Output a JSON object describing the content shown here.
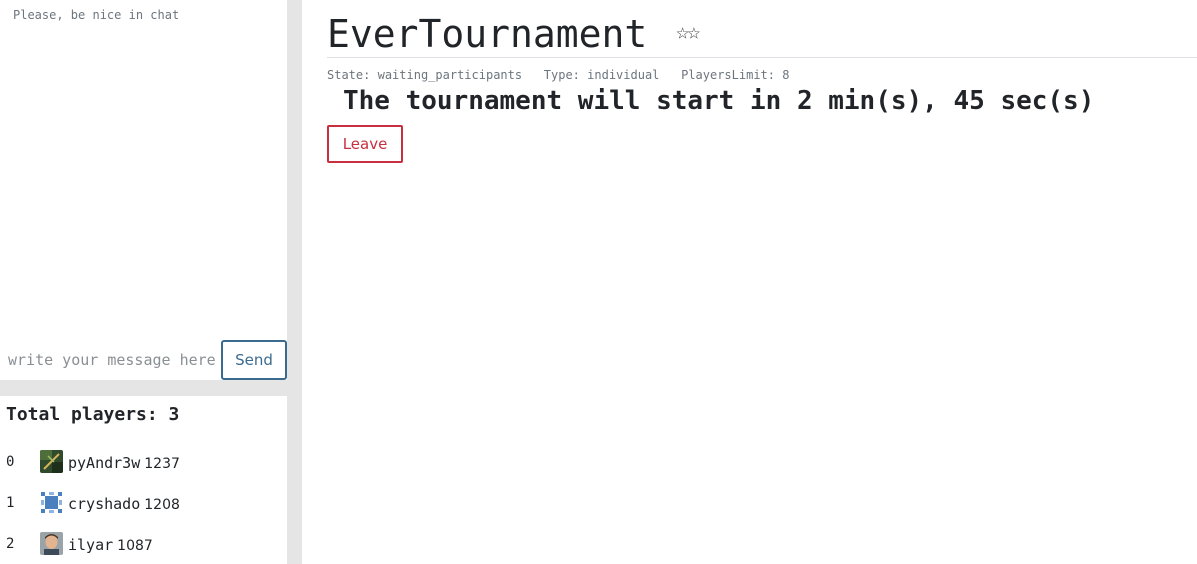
{
  "chat": {
    "notice": "Please, be nice in chat",
    "input_placeholder": "write your message here",
    "send_label": "Send"
  },
  "players": {
    "title": "Total players: 3",
    "list": [
      {
        "index": "0",
        "name": "pyAndr3w",
        "rating": "1237"
      },
      {
        "index": "1",
        "name": "cryshado",
        "rating": "1208"
      },
      {
        "index": "2",
        "name": "ilyar",
        "rating": "1087"
      }
    ]
  },
  "tournament": {
    "title": "EverTournament",
    "stars": "☆☆",
    "state_label": "State:",
    "state_value": "waiting_participants",
    "type_label": "Type:",
    "type_value": "individual",
    "limit_label": "PlayersLimit:",
    "limit_value": "8",
    "countdown": "The tournament will start in 2 min(s), 45 sec(s)",
    "leave_label": "Leave"
  },
  "colors": {
    "send_accent": "#3b6a8f",
    "leave_accent": "#c9303f",
    "sidebar_gap": "#e5e5e5"
  }
}
